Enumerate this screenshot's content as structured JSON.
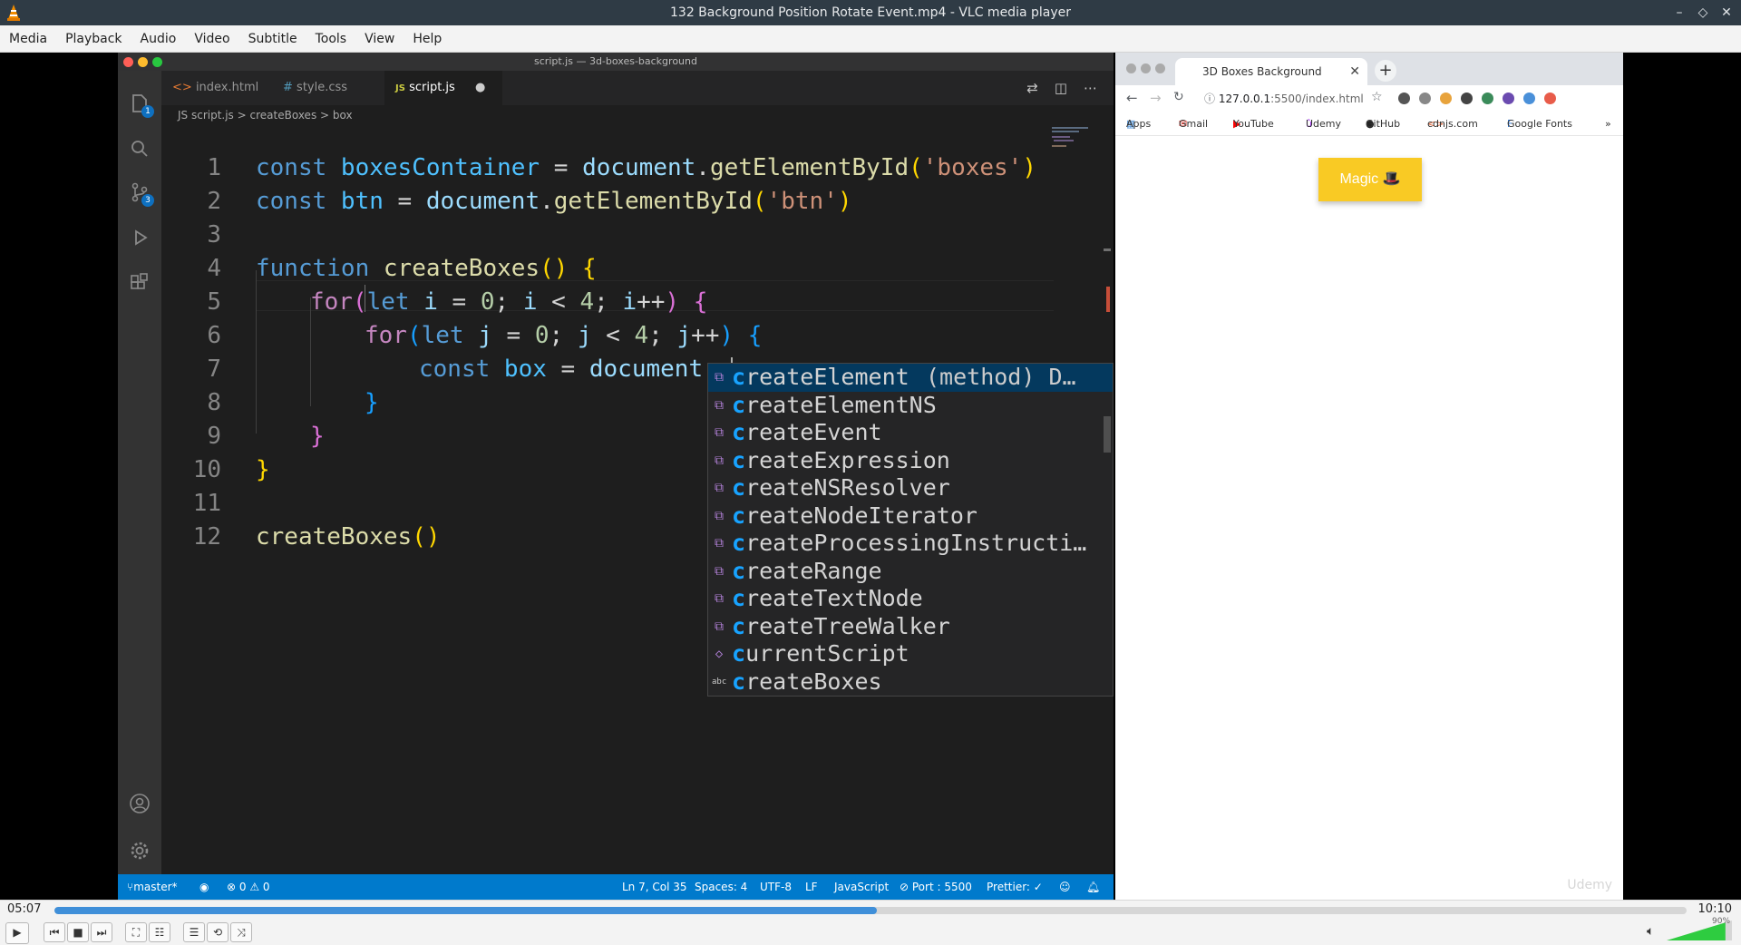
{
  "window": {
    "title": "132 Background Position Rotate Event.mp4 - VLC media player",
    "controls": [
      "–",
      "◇",
      "✕"
    ]
  },
  "menu": [
    "Media",
    "Playback",
    "Audio",
    "Video",
    "Subtitle",
    "Tools",
    "View",
    "Help"
  ],
  "vscode": {
    "title": "script.js — 3d-boxes-background",
    "tabs": [
      {
        "icon": "<>",
        "label": "index.html"
      },
      {
        "icon": "#",
        "label": "style.css"
      },
      {
        "icon": "JS",
        "label": "script.js",
        "modified": "●"
      }
    ],
    "breadcrumb": [
      "JS script.js",
      ">",
      "createBoxes",
      ">",
      "box"
    ],
    "line_numbers": [
      "1",
      "2",
      "3",
      "4",
      "5",
      "6",
      "7",
      "8",
      "9",
      "10",
      "11",
      "12"
    ],
    "code": {
      "l1": {
        "kw": "const",
        "var": " boxesContainer",
        "eq": " = ",
        "obj": "document",
        "dot": ".",
        "fn": "getElementById",
        "open": "(",
        "str": "'boxes'",
        "close": ")"
      },
      "l2": {
        "kw": "const",
        "var": " btn",
        "eq": " = ",
        "obj": "document",
        "dot": ".",
        "fn": "getElementById",
        "open": "(",
        "str": "'btn'",
        "close": ")"
      },
      "l4": {
        "kw": "function",
        "fn": " createBoxes",
        "paren": "()",
        "brace": " {"
      },
      "l5": {
        "cf": "for",
        "open": "(",
        "kw": "let",
        "v": " i",
        "a": " = ",
        "n": "0",
        "b": "; ",
        "v2": "i",
        "c": " < ",
        "n2": "4",
        "d": "; ",
        "v3": "i",
        "e": "++",
        "close": ")",
        "brace": " {"
      },
      "l6": {
        "cf": "for",
        "open": "(",
        "kw": "let",
        "v": " j",
        "a": " = ",
        "n": "0",
        "b": "; ",
        "v2": "j",
        "c": " < ",
        "n2": "4",
        "d": "; ",
        "v3": "j",
        "e": "++",
        "close": ")",
        "brace": " {"
      },
      "l7": {
        "kw": "const",
        "var": " box",
        "eq": " = ",
        "obj": "document",
        "typed": ".c"
      },
      "l8": "}",
      "l9": "}",
      "l10": "}",
      "l12": {
        "fn": "createBoxes",
        "paren": "()"
      }
    },
    "suggestions": [
      {
        "icon": "⧉",
        "match": "c",
        "rest": "reateElement",
        "detail": "(method) D…",
        "selected": true
      },
      {
        "icon": "⧉",
        "match": "c",
        "rest": "reateElementNS"
      },
      {
        "icon": "⧉",
        "match": "c",
        "rest": "reateEvent"
      },
      {
        "icon": "⧉",
        "match": "c",
        "rest": "reateExpression"
      },
      {
        "icon": "⧉",
        "match": "c",
        "rest": "reateNSResolver"
      },
      {
        "icon": "⧉",
        "match": "c",
        "rest": "reateNodeIterator"
      },
      {
        "icon": "⧉",
        "match": "c",
        "rest": "reateProcessingInstructi…"
      },
      {
        "icon": "⧉",
        "match": "c",
        "rest": "reateRange"
      },
      {
        "icon": "⧉",
        "match": "c",
        "rest": "reateTextNode"
      },
      {
        "icon": "⧉",
        "match": "c",
        "rest": "reateTreeWalker"
      },
      {
        "icon": "◇",
        "match": "c",
        "rest": "urrentScript"
      },
      {
        "icon": "abc",
        "match": "c",
        "rest": "reateBoxes"
      }
    ],
    "status": {
      "branch": "master*",
      "errors": "⊗ 0 ⚠ 0",
      "position": "Ln 7, Col 35",
      "spaces": "Spaces: 4",
      "encoding": "UTF-8",
      "eol": "LF",
      "language": "JavaScript",
      "port": "⊘ Port : 5500",
      "prettier": "Prettier: ✓"
    },
    "activity_badges": {
      "explorer": "1",
      "scm": "3"
    }
  },
  "browser": {
    "tab_title": "3D Boxes Background",
    "tab_close": "✕",
    "new_tab": "+",
    "url_host": "127.0.0.1",
    "url_rest": ":5500/index.html",
    "bookmarks": [
      "Apps",
      "Gmail",
      "YouTube",
      "Udemy",
      "GitHub",
      "cdnjs.com",
      "Google Fonts",
      "»"
    ],
    "button_label": "Magic 🎩",
    "watermark": "Udemy"
  },
  "player": {
    "elapsed": "05:07",
    "total": "10:10",
    "progress_fraction": 0.504,
    "volume_percent": 90,
    "volume_label": "90%"
  }
}
